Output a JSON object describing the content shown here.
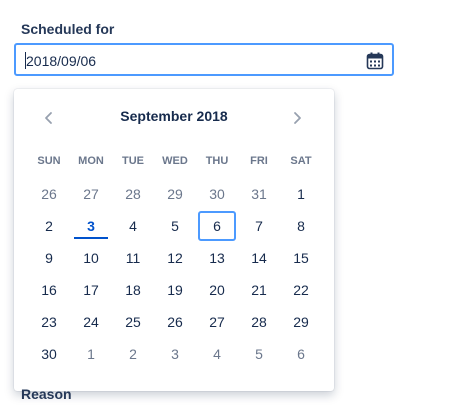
{
  "form": {
    "scheduled_label": "Scheduled for",
    "date_value": "2018/09/06",
    "reason_label": "Reason"
  },
  "calendar": {
    "month_title": "September 2018",
    "weekdays": [
      "SUN",
      "MON",
      "TUE",
      "WED",
      "THU",
      "FRI",
      "SAT"
    ],
    "weeks": [
      [
        "26",
        "27",
        "28",
        "29",
        "30",
        "31",
        "1"
      ],
      [
        "2",
        "3",
        "4",
        "5",
        "6",
        "7",
        "8"
      ],
      [
        "9",
        "10",
        "11",
        "12",
        "13",
        "14",
        "15"
      ],
      [
        "16",
        "17",
        "18",
        "19",
        "20",
        "21",
        "22"
      ],
      [
        "23",
        "24",
        "25",
        "26",
        "27",
        "28",
        "29"
      ],
      [
        "30",
        "1",
        "2",
        "3",
        "4",
        "5",
        "6"
      ]
    ],
    "outside_flags": [
      [
        true,
        true,
        true,
        true,
        true,
        true,
        false
      ],
      [
        false,
        false,
        false,
        false,
        false,
        false,
        false
      ],
      [
        false,
        false,
        false,
        false,
        false,
        false,
        false
      ],
      [
        false,
        false,
        false,
        false,
        false,
        false,
        false
      ],
      [
        false,
        false,
        false,
        false,
        false,
        false,
        false
      ],
      [
        false,
        true,
        true,
        true,
        true,
        true,
        true
      ]
    ],
    "today_day": "3",
    "selected_day": "6",
    "prev_icon": "chevron-left-icon",
    "next_icon": "chevron-right-icon"
  },
  "colors": {
    "accent": "#4c9aff",
    "today": "#0052cc",
    "text": "#172b4d",
    "muted": "#6b778c"
  }
}
